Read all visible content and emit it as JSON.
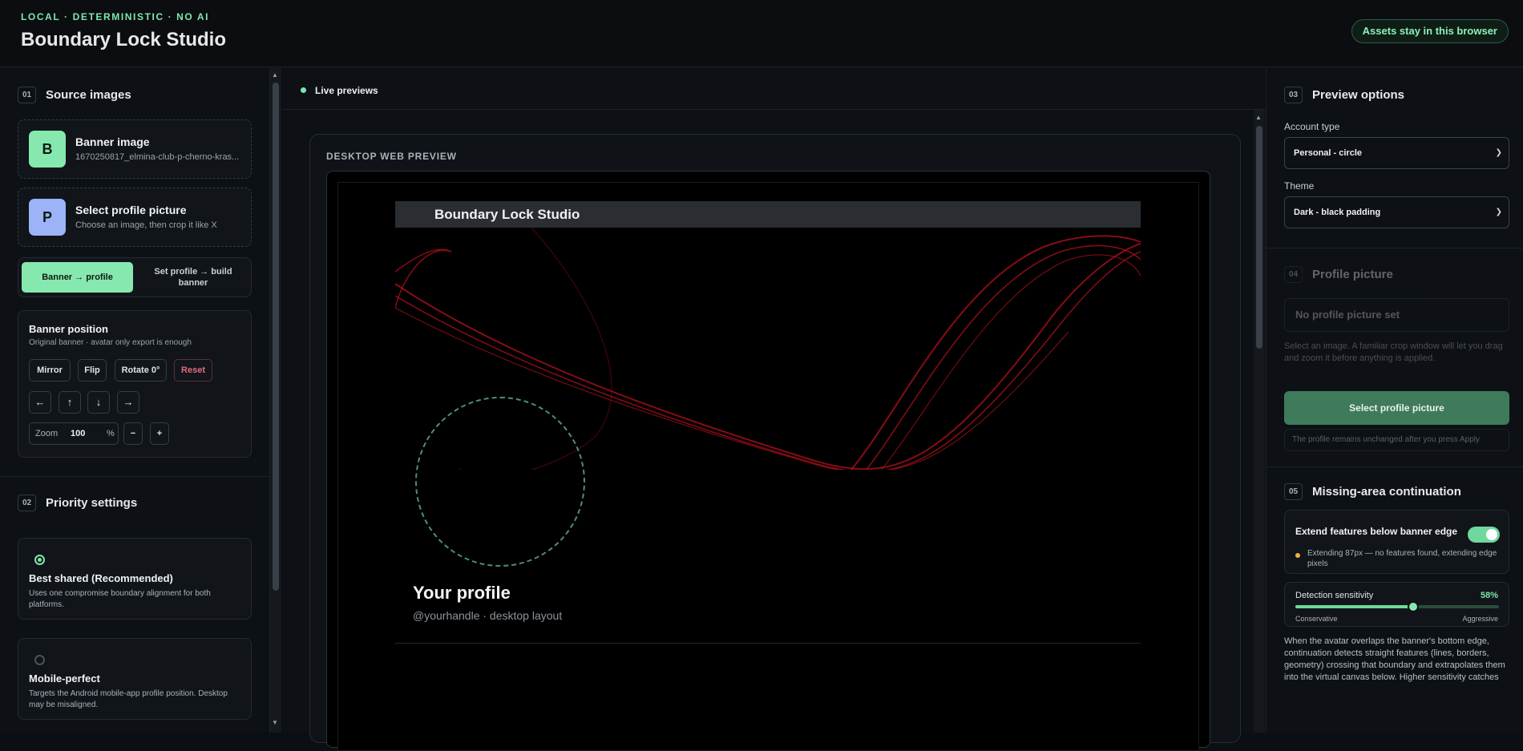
{
  "header": {
    "eyebrow": "LOCAL · DETERMINISTIC · NO AI",
    "title": "Boundary Lock Studio",
    "pill": "Assets stay in this browser"
  },
  "left": {
    "source": {
      "num": "01",
      "title": "Source images",
      "banner": {
        "letter": "B",
        "title": "Banner image",
        "filename": "1670250817_elmina-club-p-cherno-kras..."
      },
      "profile": {
        "letter": "P",
        "title": "Select profile picture",
        "sub": "Choose an image, then crop it like X"
      }
    },
    "modes": {
      "active": "Banner → profile",
      "inactive": "Set profile → build banner"
    },
    "position": {
      "title": "Banner position",
      "sub": "Original banner · avatar only export is enough",
      "mirror": "Mirror",
      "flip": "Flip",
      "rotate": "Rotate 0°",
      "reset": "Reset",
      "arrows": [
        "←",
        "↑",
        "↓",
        "→"
      ],
      "zoom_label": "Zoom",
      "zoom_value": "100",
      "zoom_unit": "%",
      "minus": "−",
      "plus": "+"
    },
    "priority": {
      "num": "02",
      "title": "Priority settings",
      "options": [
        {
          "title": "Best shared (Recommended)",
          "desc": "Uses one compromise boundary alignment for both platforms.",
          "selected": true
        },
        {
          "title": "Mobile-perfect",
          "desc": "Targets the Android mobile-app profile position. Desktop may be misaligned.",
          "selected": false
        }
      ]
    }
  },
  "center": {
    "live": "Live previews",
    "panel_title": "DESKTOP WEB PREVIEW",
    "mock_header": "Boundary Lock Studio",
    "profile_name": "Your profile",
    "profile_handle": "@yourhandle · desktop layout"
  },
  "right": {
    "preview_options": {
      "num": "03",
      "title": "Preview options",
      "account_label": "Account type",
      "account_value": "Personal - circle",
      "theme_label": "Theme",
      "theme_value": "Dark - black padding"
    },
    "profile_picture": {
      "num": "04",
      "title": "Profile picture",
      "empty": "No profile picture set",
      "desc": "Select an image. A familiar crop window will let you drag and zoom it before anything is applied.",
      "button": "Select profile picture",
      "note": "The profile remains unchanged after you press Apply"
    },
    "continuation": {
      "num": "05",
      "title": "Missing-area continuation",
      "toggle_label": "Extend features below banner edge",
      "toggle_on": true,
      "status": "Extending 87px — no features found, extending edge pixels",
      "sensitivity_label": "Detection sensitivity",
      "sensitivity_value": "58%",
      "sensitivity_fraction": 0.58,
      "min_label": "Conservative",
      "max_label": "Aggressive",
      "desc": "When the avatar overlaps the banner's bottom edge, continuation detects straight features (lines, borders, geometry) crossing that boundary and extrapolates them into the virtual canvas below. Higher sensitivity catches"
    }
  },
  "colors": {
    "accent": "#7ee8ac",
    "danger": "#e36b7a",
    "warning": "#f0b43c",
    "avatar_b": "#86e8ae",
    "avatar_p": "#9db3f7"
  },
  "icons": [
    "status-dot-icon",
    "caret-down-icon",
    "arrow-left-icon",
    "arrow-up-icon",
    "arrow-down-icon",
    "arrow-right-icon"
  ]
}
